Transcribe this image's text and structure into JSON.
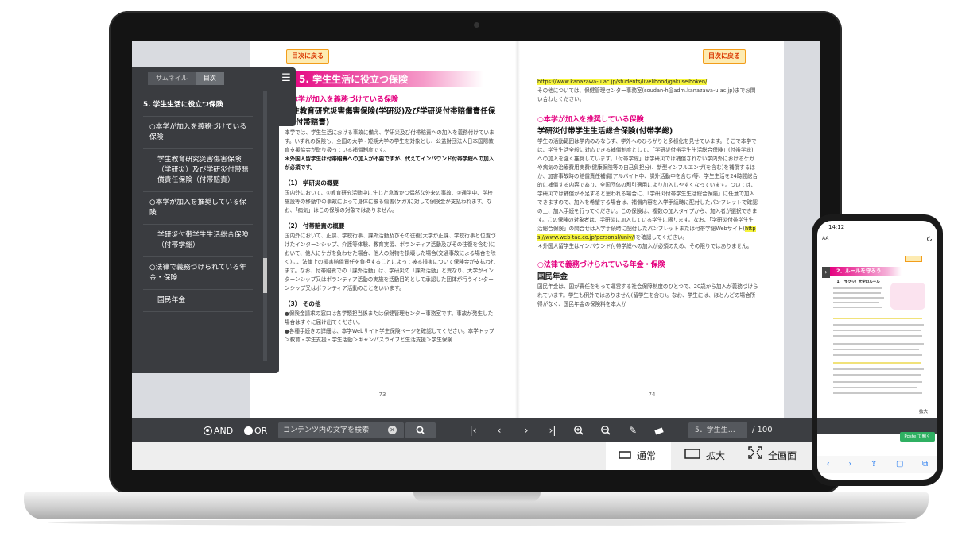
{
  "viewer": {
    "toc_button": "目次に戻る",
    "toc_panel": {
      "tabs": [
        "サムネイル",
        "目次"
      ],
      "menu_icon": "menu-icon",
      "items": [
        {
          "text": "5. 学生生活に役立つ保険",
          "level": 0
        },
        {
          "text": "○本学が加入を義務づけている保険",
          "level": 1
        },
        {
          "text": "学生教育研究災害傷害保険（学研災）及び学研災付帯賠償責任保険（付帯賠責）",
          "level": 2
        },
        {
          "text": "○本学が加入を推奨している保険",
          "level": 1
        },
        {
          "text": "学研災付帯学生生活総合保険（付帯学総）",
          "level": 2
        },
        {
          "text": "○法律で義務づけられている年金・保険",
          "level": 1
        },
        {
          "text": "国民年金",
          "level": 2
        }
      ]
    },
    "left_page": {
      "chapter": "5. 学生生活に役立つ保険",
      "pink_heading": "○本学が加入を義務づけている保険",
      "bold_heading": "学生教育研究災害傷害保険(学研災)及び学研災付帯賠償責任保険(付帯賠責)",
      "intro": "本学では、学生生活における事故に備え、学研災及び付帯賠責への加入を義務付けています。いずれの保険も、全国の大学・短期大学の学生を対象とし、公益財団法人日本国際教育支援協会が取り扱っている補償制度です。",
      "note1": "＊外国人留学生は付帯賠責への加入が不要ですが、代えてインバウンド付帯学総への加入が必須です。",
      "sec1_title": "（1） 学研災の概要",
      "sec1_body": "国内外において、①教育研究活動中に生じた急激かつ偶然な外来の事故、②通学中、学校施設等の移動中の事故によって身体に被る傷害(ケガ)に対して保険金が支払われます。なお、「病気」はこの保険の対象ではありません。",
      "sec2_title": "（2） 付帯賠責の概要",
      "sec2_body": "国内外において、正課、学校行事、課外活動及びその往復(大学が正課、学校行事と位置づけたインターンシップ、介護等体験、教育実習、ボランティア活動及びその往復を含む)において、他人にケガを負わせた場合、他人の財物を損壊した場合(交通事故による場合を除く)に、法律上の損害賠償責任を負担することによって被る損害について保険金が支払われます。なお、付帯賠責での「課外活動」は、学研災の「課外活動」と異なり、大学がインターンシップ又はボランティア活動の実施を活動目的として承認した団体が行うインターンシップ又はボランティア活動のことをいいます。",
      "sec3_title": "（3） その他",
      "sec3_b1": "●保険金請求の窓口は各学類担当係または保健管理センター事務室です。事故が発生した場合はすぐに届け出てください。",
      "sec3_b2": "●各種手続きの詳細は、本学Webサイト学生保険ページを確認してください。本学トップ＞教育・学生支援・学生活動＞キャンパスライフと生活支援＞学生保険",
      "page_number": "— 73 —"
    },
    "right_page": {
      "url1": "https://www.kanazawa-u.ac.jp/students/livelihood/gakuseihoken/",
      "contact": "その他については、保健管理センター事務室(soudan-h@adm.kanazawa-u.ac.jp)までお問い合わせください。",
      "pink_heading1": "○本学が加入を推奨している保険",
      "bold_heading1": "学研災付帯学生生活総合保険(付帯学総)",
      "body1": "学生の活動範囲は学内のみならず、学外へのひろがりと多様化を見せています。そこで本学では、学生生活全般に対応できる補償制度として、「学研災付帯学生生活総合保険」(付帯学総)への加入を強く推奨しています。「付帯学総」は学研災では補償されない学内外におけるケガや病気の治療費用実費(健康保険等の自己負担分)、新型インフルエンザ(を含む)を補償するほか、加害事故時の賠償責任補償(アルバイト中、課外活動中を含む)等、学生生活を24時間総合的に補償する内容であり、全国団体の割引適用により加入しやすくなっています。ついては、学研災では補償が不足すると思われる場合に、「学研災付帯学生生活総合保険」に任意で加入できますので、加入を希望する場合は、補償内容を入学手続時に配付したパンフレットで確認の上、加入手続を行ってください。この保険は、複数の加入タイプから、加入者が選択できます。この保険の対象者は、学研災に加入している学生に限ります。なお、「学研災付帯学生生活総合保険」の問合せは入学手続時に配付したパンフレットまたは付帯学総Webサイト(",
      "url2": "https://www.web-tac.co.jp/personal/univ/",
      "body1_end": ")を確認してください。",
      "note2": "＊外国人留学生はインバウンド付帯学総への加入が必須のため、その限りではありません。",
      "pink_heading2": "○法律で義務づけられている年金・保険",
      "bold_heading2": "国民年金",
      "body2": "国民年金は、国が責任をもって運営する社会保障制度のひとつで、20歳から加入が義務づけられています。学生も例外ではありません(留学生を含む)。なお、学生には、ほとんどの場合所得がなく、国民年金の保険料を本人が",
      "page_number": "— 74 —"
    },
    "search": {
      "and_label": "AND",
      "or_label": "OR",
      "placeholder": "コンテンツ内の文字を検索",
      "clear_icon": "clear-icon",
      "search_icon": "search-icon"
    },
    "nav": {
      "page_field": "5．学生生…",
      "total": "/ 100"
    },
    "modes": [
      {
        "label": "通常",
        "icon": "normal-view-icon",
        "active": true
      },
      {
        "label": "拡大",
        "icon": "zoom-view-icon",
        "active": false
      },
      {
        "label": "全画面",
        "icon": "fullscreen-icon",
        "active": false
      }
    ]
  },
  "phone": {
    "time": "14:12",
    "aa": "AA",
    "chapter": "2．ルールを守ろう",
    "sub": "（1） サクッ！大学のルール",
    "zoom_label": "拡大",
    "green_label": "Poste で開く"
  }
}
